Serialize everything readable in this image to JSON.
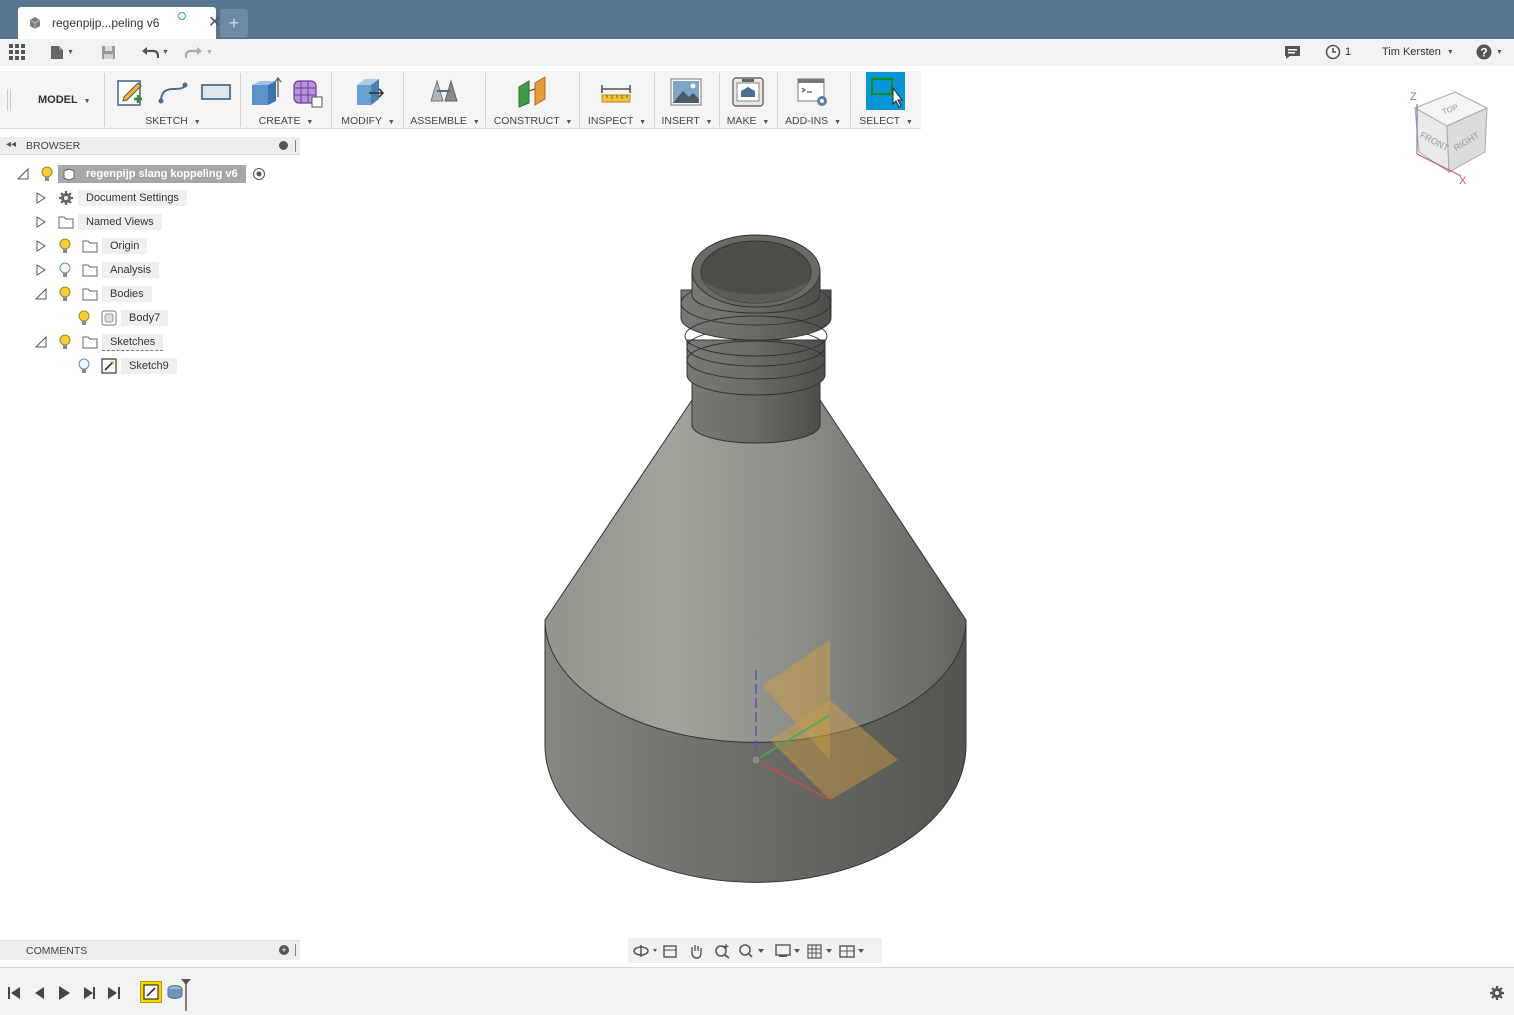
{
  "tab": {
    "title": "regenpijp...peling v6"
  },
  "quickbar": {
    "job_count": "1",
    "user_name": "Tim Kersten"
  },
  "toolbar": {
    "workspace": "MODEL",
    "groups": {
      "sketch": "SKETCH",
      "create": "CREATE",
      "modify": "MODIFY",
      "assemble": "ASSEMBLE",
      "construct": "CONSTRUCT",
      "inspect": "INSPECT",
      "insert": "INSERT",
      "make": "MAKE",
      "addins": "ADD-INS",
      "select": "SELECT"
    }
  },
  "browser": {
    "title": "BROWSER",
    "root": "regenpijp slang koppeling v6",
    "items": {
      "doc_settings": "Document Settings",
      "named_views": "Named Views",
      "origin": "Origin",
      "analysis": "Analysis",
      "bodies": "Bodies",
      "body7": "Body7",
      "sketches": "Sketches",
      "sketch9": "Sketch9"
    }
  },
  "comments": {
    "title": "COMMENTS"
  },
  "viewcube": {
    "top": "TOP",
    "front": "FRONT",
    "right": "RIGHT",
    "z": "Z",
    "x": "X"
  },
  "colors": {
    "titlebar": "#587591",
    "select_active": "#0696d7",
    "body_gray": "#8a8a84"
  }
}
